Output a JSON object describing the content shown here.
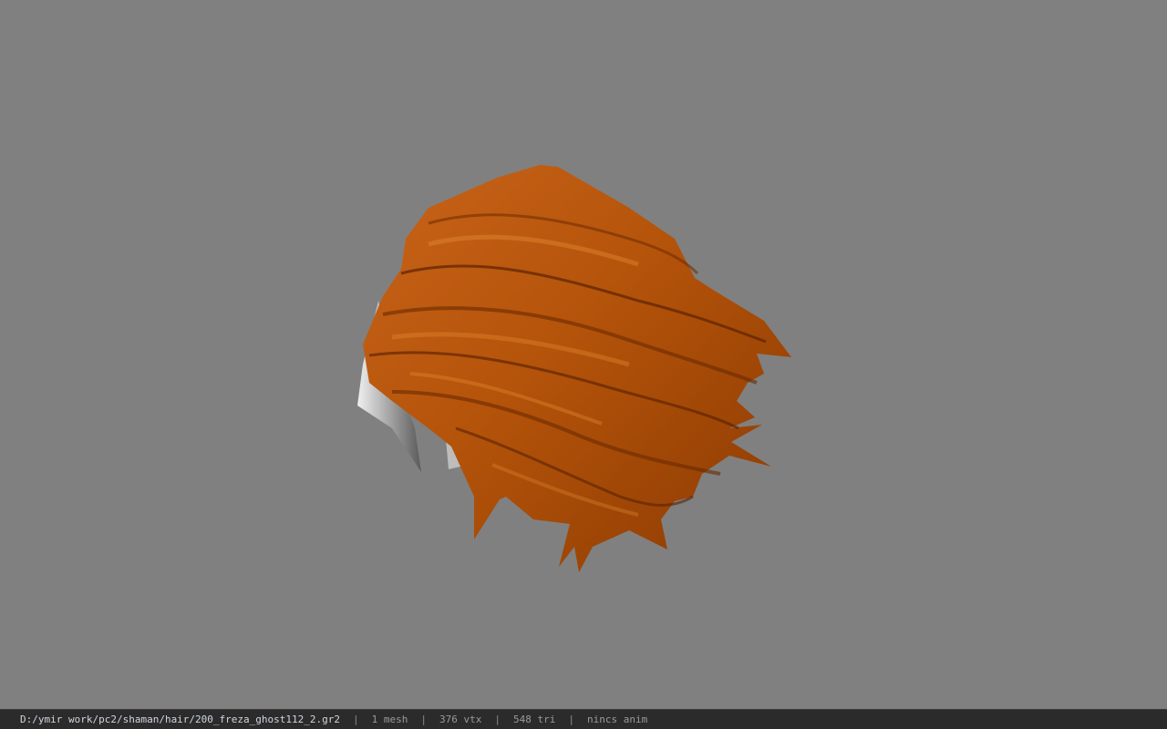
{
  "viewport": {
    "background": "#808080",
    "model_icon": "hair-mesh-model"
  },
  "status_bar": {
    "file_path": "D:/ymir work/pc2/shaman/hair/200_freza_ghost112_2.gr2",
    "separator": "|",
    "mesh_count": "1 mesh",
    "vertex_count": "376 vtx",
    "triangle_count": "548 tri",
    "anim_status": "nincs anim"
  },
  "colors": {
    "hair_dark": "#6b2a00",
    "hair_mid": "#b4530a",
    "hair_light": "#d7761e",
    "skin_gray": "#cfcfcf",
    "status_bg": "#2b2b2b"
  }
}
